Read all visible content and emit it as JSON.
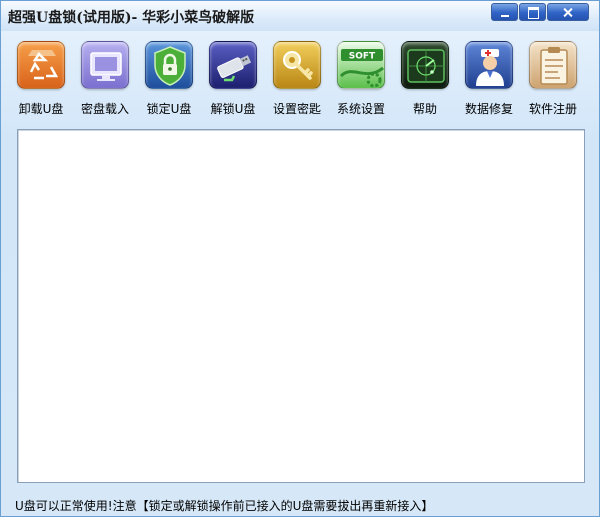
{
  "window": {
    "title": "超强U盘锁(试用版)- 华彩小菜鸟破解版"
  },
  "toolbar": {
    "items": [
      {
        "label": "卸载U盘",
        "icon": "recycle-icon",
        "color": "#e87722"
      },
      {
        "label": "密盘载入",
        "icon": "monitor-icon",
        "color": "#8a7fd6"
      },
      {
        "label": "锁定U盘",
        "icon": "shield-lock-icon",
        "color": "#2f6fbf"
      },
      {
        "label": "解锁U盘",
        "icon": "usb-drive-icon",
        "color": "#2b2f8c"
      },
      {
        "label": "设置密匙",
        "icon": "key-icon",
        "color": "#c99a1e"
      },
      {
        "label": "系统设置",
        "icon": "soft-gear-icon",
        "color": "#3a9a3a"
      },
      {
        "label": "帮助",
        "icon": "radar-icon",
        "color": "#1d3b1d"
      },
      {
        "label": "数据修复",
        "icon": "doctor-icon",
        "color": "#2d4fa8"
      },
      {
        "label": "软件注册",
        "icon": "clipboard-icon",
        "color": "#d9b88c"
      }
    ]
  },
  "status": {
    "text": "U盘可以正常使用!注意【锁定或解锁操作前已接入的U盘需要拔出再重新接入】"
  }
}
